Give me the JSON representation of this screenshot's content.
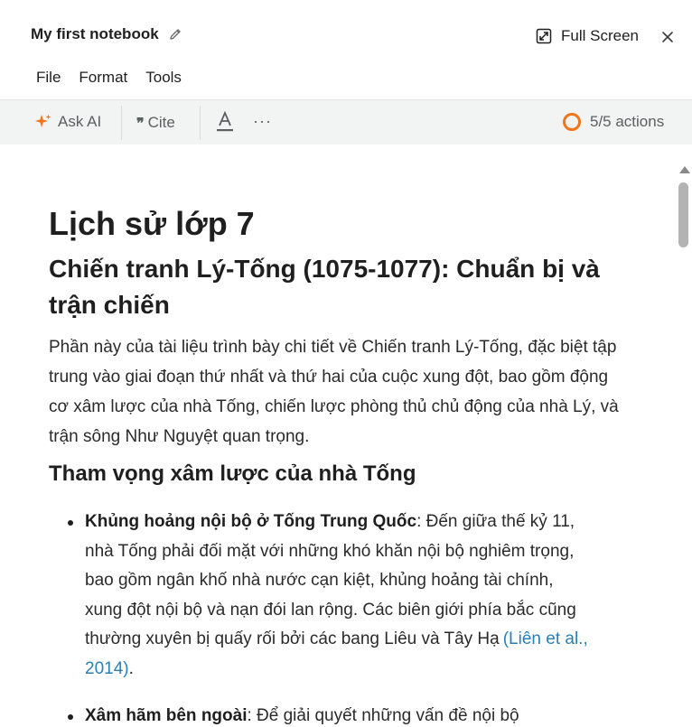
{
  "header": {
    "title": "My first notebook",
    "full_screen_label": "Full Screen"
  },
  "menu": [
    "File",
    "Format",
    "Tools"
  ],
  "toolbar": {
    "ask_ai": "Ask AI",
    "cite": "Cite",
    "more": "···",
    "actions": "5/5 actions",
    "accent_color": "#f2741b"
  },
  "doc": {
    "h1": "Lịch sử lớp 7",
    "h2": "Chiến tranh Lý-Tống (1075-1077): Chuẩn bị và trận chiến",
    "intro": "Phần này của tài liệu trình bày chi tiết về Chiến tranh Lý-Tống, đặc biệt tập trung vào giai đoạn thứ nhất và thứ hai của cuộc xung đột, bao gồm động cơ xâm lược của nhà Tống, chiến lược phòng thủ chủ động của nhà Lý, và trận sông Như Nguyệt quan trọng.",
    "h3": "Tham vọng xâm lược của nhà Tống",
    "bullets": [
      {
        "bold": "Khủng hoảng nội bộ ở Tống Trung Quốc",
        "text": ": Đến giữa thế kỷ 11, nhà Tống phải đối mặt với những khó khăn nội bộ nghiêm trọng, bao gồm ngân khố nhà nước cạn kiệt, khủng hoảng tài chính, xung đột nội bộ và nạn đói lan rộng. Các biên giới phía bắc cũng thường xuyên bị quấy rối bởi các bang Liêu và Tây Hạ",
        "cite": "(Liên et al., 2014)",
        "end": "."
      },
      {
        "bold": "Xâm hãm bên ngoài",
        "text": ": Để giải quyết những vấn đề nội bộ",
        "cite": "",
        "end": ""
      }
    ]
  }
}
